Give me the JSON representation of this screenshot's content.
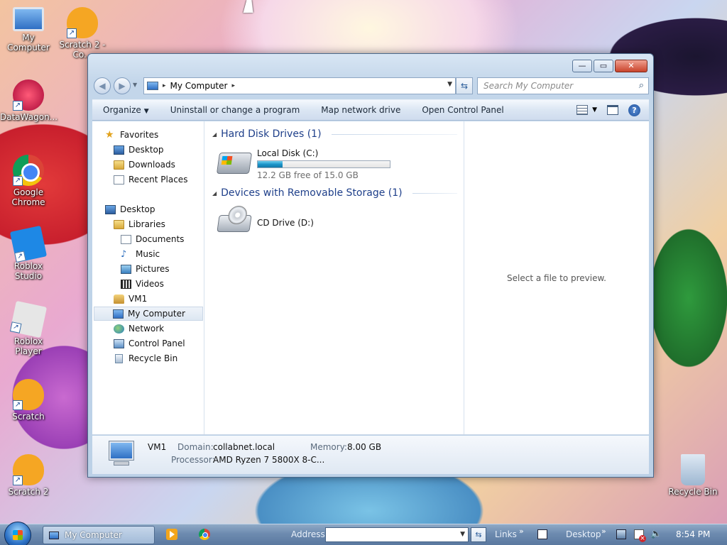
{
  "desktop": {
    "icons": [
      {
        "label": "My Computer",
        "icon": "monitor-icon"
      },
      {
        "label": "Scratch 2 - Co...",
        "icon": "scratch-cat-icon"
      },
      {
        "label": "DataWagon...",
        "icon": "datawagon-icon"
      },
      {
        "label": "Google Chrome",
        "icon": "chrome-icon"
      },
      {
        "label": "Roblox Studio",
        "icon": "roblox-studio-icon"
      },
      {
        "label": "Roblox Player",
        "icon": "roblox-player-icon"
      },
      {
        "label": "Scratch",
        "icon": "scratch-cat-icon"
      },
      {
        "label": "Scratch 2",
        "icon": "scratch-cat-icon"
      },
      {
        "label": "Recycle Bin",
        "icon": "recycle-bin-icon"
      }
    ]
  },
  "window": {
    "title_buttons": {
      "minimize": "—",
      "maximize": "▭",
      "close": "✕"
    },
    "address": {
      "crumb": "My Computer",
      "sep": "▸"
    },
    "search": {
      "placeholder": "Search My Computer"
    },
    "toolbar": {
      "organize": "Organize",
      "uninstall": "Uninstall or change a program",
      "map_drive": "Map network drive",
      "control_panel": "Open Control Panel"
    },
    "nav": {
      "favorites": "Favorites",
      "fav_desktop": "Desktop",
      "downloads": "Downloads",
      "recent": "Recent Places",
      "desktop": "Desktop",
      "libraries": "Libraries",
      "documents": "Documents",
      "music": "Music",
      "pictures": "Pictures",
      "videos": "Videos",
      "vm1": "VM1",
      "my_computer": "My Computer",
      "network": "Network",
      "control_panel": "Control Panel",
      "recycle_bin": "Recycle Bin"
    },
    "groups": {
      "hdd": "Hard Disk Drives (1)",
      "removable": "Devices with Removable Storage (1)"
    },
    "drives": {
      "c": {
        "name": "Local Disk (C:)",
        "free": "12.2 GB free of 15.0 GB",
        "used_fraction": 0.187
      },
      "d": {
        "name": "CD Drive (D:)"
      }
    },
    "preview": "Select a file to preview.",
    "details": {
      "name": "VM1",
      "domain_label": "Domain:",
      "domain": "collabnet.local",
      "memory_label": "Memory:",
      "memory": "8.00 GB",
      "processor_label": "Processor:",
      "processor": "AMD Ryzen 7 5800X 8-C..."
    }
  },
  "taskbar": {
    "task": "My Computer",
    "address_label": "Address",
    "links": "Links",
    "desktop": "Desktop",
    "chevron": "»",
    "clock": "8:54 PM"
  },
  "colors": {
    "accent": "#1e3f8a",
    "progress": "#1c95c9",
    "taskbar": "#6d8bb0"
  }
}
